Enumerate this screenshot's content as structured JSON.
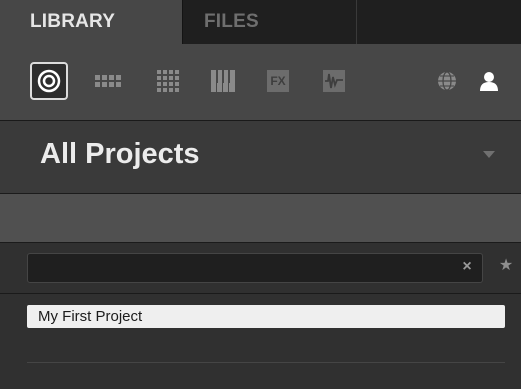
{
  "tabs": [
    {
      "label": "LIBRARY",
      "active": true
    },
    {
      "label": "FILES",
      "active": false
    }
  ],
  "toolbar": {
    "icons": [
      {
        "name": "project-icon",
        "selected": true
      },
      {
        "name": "group-icon"
      },
      {
        "name": "sound-icon"
      },
      {
        "name": "instrument-icon"
      },
      {
        "name": "fx-icon",
        "text": "FX"
      },
      {
        "name": "sample-icon"
      },
      {
        "name": "globe-icon"
      },
      {
        "name": "user-icon"
      }
    ]
  },
  "header": {
    "title": "All Projects"
  },
  "search": {
    "value": "",
    "clear_symbol": "×",
    "favorite_symbol": "★"
  },
  "results": [
    {
      "label": "My First Project",
      "selected": true
    }
  ],
  "colors": {
    "background": "#2f2f2f",
    "tab_active": "#474747",
    "selected_row": "#efefef"
  }
}
